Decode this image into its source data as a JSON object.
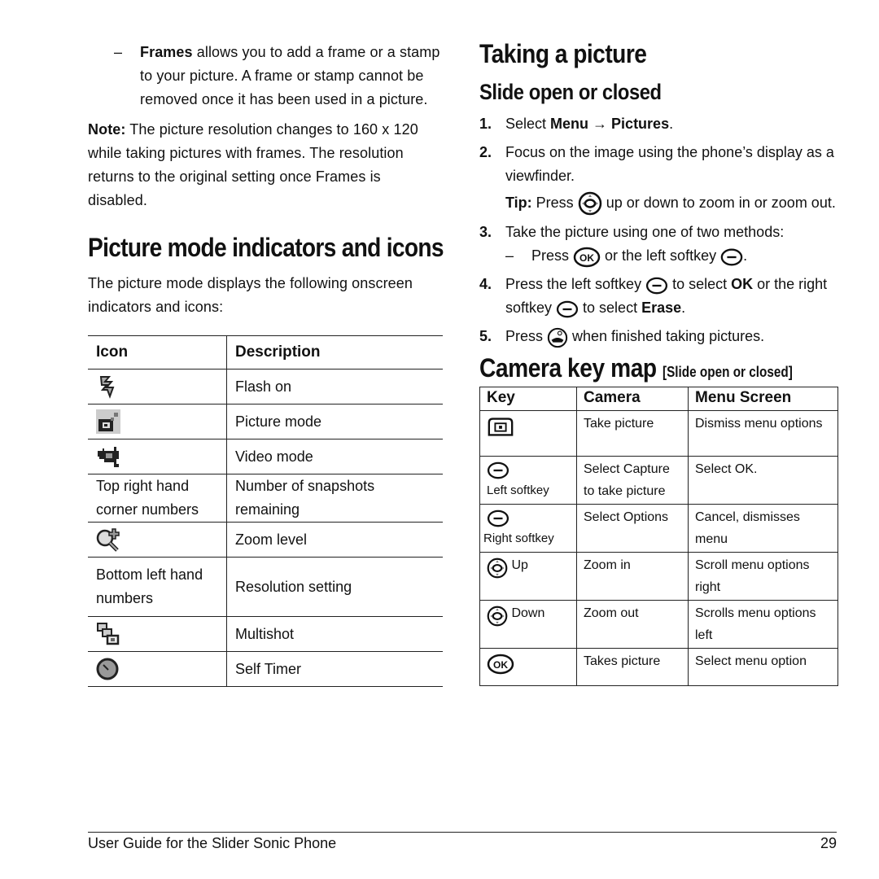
{
  "left": {
    "frames_item": {
      "bullet": "–",
      "term": "Frames",
      "text": " allows you to add a frame or a stamp to your picture. A frame or stamp cannot be removed once it has been used in a picture."
    },
    "note": {
      "label": "Note:",
      "text": "  The picture resolution changes to 160 x 120 while taking pictures with frames. The resolution returns to the original setting once Frames is disabled."
    },
    "section_title": "Picture mode indicators and icons",
    "intro": "The picture mode displays the following onscreen indicators and icons:",
    "icon_table": {
      "headers": [
        "Icon",
        "Description"
      ],
      "rows": [
        {
          "icon": "flash-icon",
          "label": "",
          "description": "Flash on"
        },
        {
          "icon": "picture-mode-icon",
          "label": "",
          "description": "Picture mode"
        },
        {
          "icon": "video-mode-icon",
          "label": "",
          "description": "Video mode"
        },
        {
          "icon": "",
          "label": "Top right hand corner numbers",
          "description": "Number of snapshots remaining"
        },
        {
          "icon": "zoom-level-icon",
          "label": "",
          "description": "Zoom level"
        },
        {
          "icon": "",
          "label": "Bottom left hand numbers",
          "description": "Resolution setting"
        },
        {
          "icon": "multishot-icon",
          "label": "",
          "description": "Multishot"
        },
        {
          "icon": "self-timer-icon",
          "label": "",
          "description": "Self Timer"
        }
      ]
    }
  },
  "right": {
    "title": "Taking a picture",
    "subtitle": "Slide open or closed",
    "steps": [
      {
        "num": "1.",
        "pre": "Select ",
        "b1": "Menu",
        "arrow": " → ",
        "b2": "Pictures",
        "post": "."
      },
      {
        "num": "2.",
        "text": "Focus on the image using the phone’s display as a viewfinder.",
        "tip_label": "Tip:",
        "tip_pre": "  Press ",
        "tip_post": " up or down to zoom in or zoom out."
      },
      {
        "num": "3.",
        "text": "Take the picture using one of two methods:",
        "sub_bullet": "–",
        "sub_pre": "Press ",
        "sub_mid": " or the left softkey ",
        "sub_post": "."
      },
      {
        "num": "4.",
        "pre": "Press the left softkey ",
        "mid1": " to select ",
        "b1": "OK",
        "mid2": " or the right softkey ",
        "mid3": " to select ",
        "b2": "Erase",
        "post": "."
      },
      {
        "num": "5.",
        "pre": "Press ",
        "post": " when finished taking pictures."
      }
    ],
    "keymap_title": "Camera key map",
    "keymap_subtitle": "[Slide open or closed]",
    "key_table": {
      "headers": [
        "Key",
        "Camera",
        "Menu Screen"
      ],
      "rows": [
        {
          "icon": "camera-key-icon",
          "key_label": "",
          "camera": "Take picture",
          "menu": "Dismiss menu options"
        },
        {
          "icon": "left-softkey-icon",
          "key_label": "Left softkey",
          "camera": "Select Capture to take picture",
          "menu": "Select OK."
        },
        {
          "icon": "right-softkey-icon",
          "key_label": "Right softkey",
          "camera": "Select Options",
          "menu": "Cancel, dismisses menu"
        },
        {
          "icon": "nav-key-icon",
          "key_label": "Up",
          "camera": "Zoom in",
          "menu": "Scroll menu options right"
        },
        {
          "icon": "nav-key-icon",
          "key_label": "Down",
          "camera": "Zoom out",
          "menu": "Scrolls menu options left"
        },
        {
          "icon": "ok-key-icon",
          "key_label": "",
          "camera": "Takes picture",
          "menu": "Select menu option"
        }
      ]
    }
  },
  "footer": {
    "title": "User Guide for the Slider Sonic Phone",
    "page": "29"
  }
}
